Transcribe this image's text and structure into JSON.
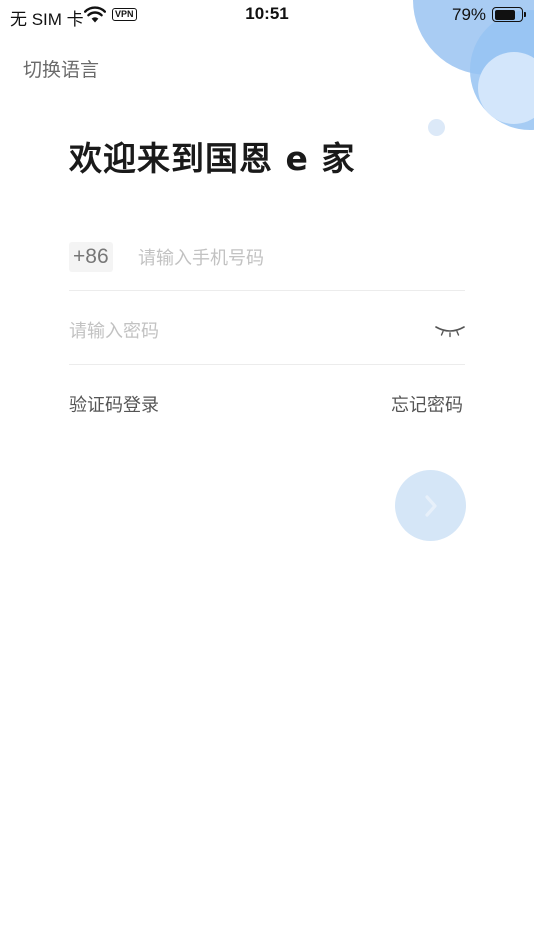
{
  "status_bar": {
    "carrier": "无 SIM 卡",
    "vpn": "VPN",
    "time": "10:51",
    "battery_pct": "79%",
    "battery_level": 0.79
  },
  "header": {
    "language_switch": "切换语言"
  },
  "welcome": {
    "title": "欢迎来到国恩 e 家"
  },
  "form": {
    "country_code": "+86",
    "phone_placeholder": "请输入手机号码",
    "phone_value": "",
    "password_placeholder": "请输入密码",
    "password_value": "",
    "sms_login": "验证码登录",
    "forgot_password": "忘记密码"
  },
  "icons": {
    "wifi": "wifi-icon",
    "battery": "battery-icon",
    "eye": "eye-closed-icon",
    "next": "chevron-right-icon"
  },
  "colors": {
    "bubble_primary": "#a9ccf3",
    "bubble_secondary": "#96c3f2",
    "next_button": "#d5e6f7",
    "placeholder": "#c2c2c2"
  }
}
